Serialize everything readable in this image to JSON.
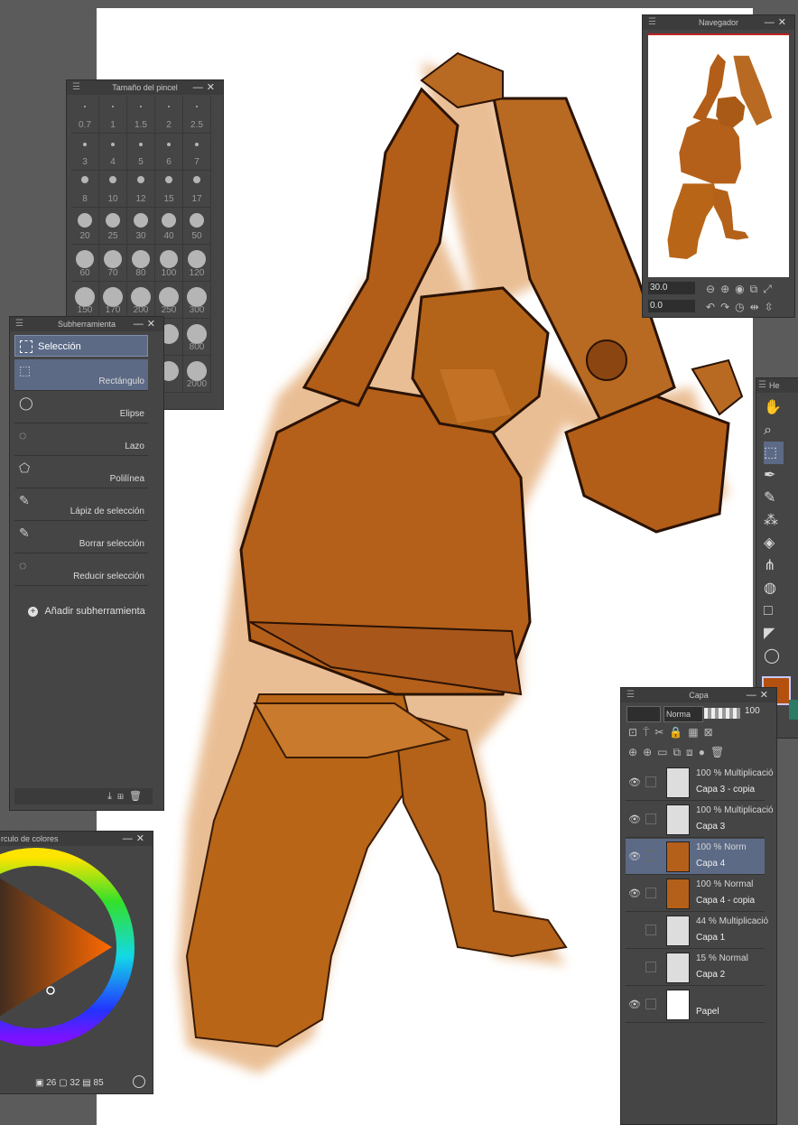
{
  "brush_size": {
    "title": "Tamaño del pincel",
    "sizes": [
      "0.7",
      "1",
      "1.5",
      "2",
      "2.5",
      "3",
      "4",
      "5",
      "6",
      "7",
      "8",
      "10",
      "12",
      "15",
      "17",
      "20",
      "25",
      "30",
      "40",
      "50",
      "60",
      "70",
      "80",
      "100",
      "120",
      "150",
      "170",
      "200",
      "250",
      "300",
      "",
      "",
      "",
      "",
      "800",
      "",
      "",
      "",
      "",
      "2000"
    ]
  },
  "subtool": {
    "title": "Subherramienta",
    "group": "Selección",
    "items": [
      "Rectángulo",
      "Elipse",
      "Lazo",
      "Polilínea",
      "Lápiz de selección",
      "Borrar selección",
      "Reducir selección"
    ],
    "add_label": "Añadir subherramienta"
  },
  "navigator": {
    "title": "Navegador",
    "zoom": "30.0",
    "rotation": "0.0"
  },
  "color_circle": {
    "title": "rculo de colores",
    "current_color": "#b5510f",
    "values": [
      "26",
      "32",
      "85"
    ]
  },
  "tools_panel": {
    "title": "He"
  },
  "layer": {
    "title": "Capa",
    "blend_mode": "Norma",
    "opacity": "100",
    "layers": [
      {
        "mode": "100 % Multiplicació",
        "name": "Capa 3 - copia"
      },
      {
        "mode": "100 % Multiplicació",
        "name": "Capa 3"
      },
      {
        "mode": "100 % Norm",
        "name": "Capa 4"
      },
      {
        "mode": "100 % Normal",
        "name": "Capa 4 - copia"
      },
      {
        "mode": "44 % Multiplicació",
        "name": "Capa 1"
      },
      {
        "mode": "15 % Normal",
        "name": "Capa 2"
      },
      {
        "mode": "",
        "name": "Papel"
      }
    ]
  },
  "colors": {
    "accent": "#5c6a86",
    "panel": "#454545",
    "orange": "#b5510f"
  }
}
